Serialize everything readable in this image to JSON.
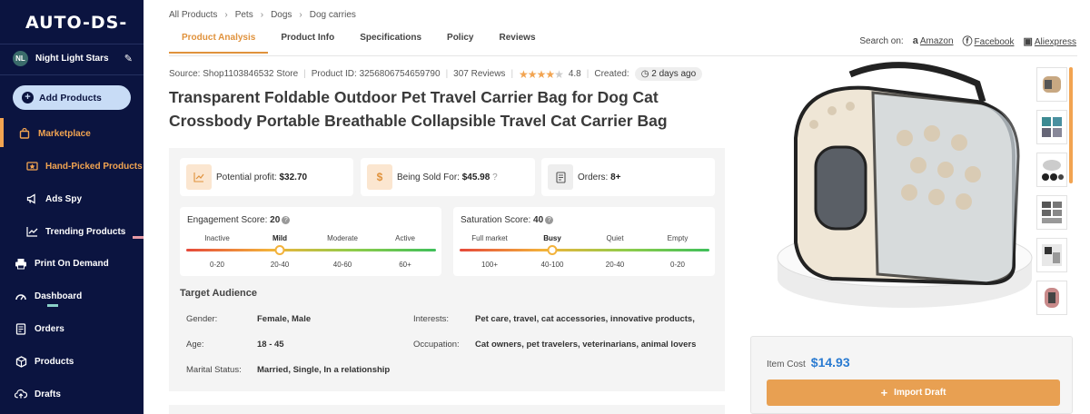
{
  "sidebar": {
    "logo": "AUTO-DS-",
    "store": {
      "initials": "NL",
      "name": "Night Light Stars"
    },
    "add_button": "Add Products",
    "items": [
      {
        "label": "Marketplace",
        "icon": "bag-icon"
      },
      {
        "label": "Hand-Picked Products",
        "icon": "star-icon"
      },
      {
        "label": "Ads Spy",
        "icon": "megaphone-icon"
      },
      {
        "label": "Trending Products",
        "icon": "trend-icon"
      },
      {
        "label": "Print On Demand",
        "icon": "printer-icon"
      },
      {
        "label": "Dashboard",
        "icon": "gauge-icon"
      },
      {
        "label": "Orders",
        "icon": "orders-icon"
      },
      {
        "label": "Products",
        "icon": "box-icon"
      },
      {
        "label": "Drafts",
        "icon": "cloud-upload-icon"
      }
    ]
  },
  "breadcrumb": [
    "All Products",
    "Pets",
    "Dogs",
    "Dog carries"
  ],
  "tabs": [
    "Product Analysis",
    "Product Info",
    "Specifications",
    "Policy",
    "Reviews"
  ],
  "search_on": {
    "label": "Search on:",
    "links": [
      "Amazon",
      "Facebook",
      "Aliexpress"
    ]
  },
  "meta": {
    "source": "Source: Shop1103846532 Store",
    "product_id": "Product ID: 3256806754659790",
    "reviews": "307 Reviews",
    "rating": "4.8",
    "rating_value": 4,
    "created_label": "Created:",
    "created_value": "2 days ago"
  },
  "product": {
    "title_line1": "Transparent Foldable Outdoor Pet Travel Carrier Bag for Dog Cat",
    "title_line2": "Crossbody Portable Breathable Collapsible Travel Cat Carrier Bag"
  },
  "stats": {
    "profit_label": "Potential profit:",
    "profit_value": "$32.70",
    "sold_label": "Being Sold For:",
    "sold_value": "$45.98",
    "orders_label": "Orders:",
    "orders_value": "8+"
  },
  "engagement": {
    "label": "Engagement Score:",
    "score": "20",
    "levels": [
      "Inactive",
      "Mild",
      "Moderate",
      "Active"
    ],
    "ranges": [
      "0-20",
      "20-40",
      "40-60",
      "60+"
    ],
    "active_level": 1
  },
  "saturation": {
    "label": "Saturation Score:",
    "score": "40",
    "levels": [
      "Full market",
      "Busy",
      "Quiet",
      "Empty"
    ],
    "ranges": [
      "100+",
      "40-100",
      "20-40",
      "0-20"
    ],
    "active_level": 1
  },
  "audience": {
    "title": "Target Audience",
    "gender_label": "Gender:",
    "gender_value": "Female, Male",
    "age_label": "Age:",
    "age_value": "18 - 45",
    "marital_label": "Marital Status:",
    "marital_value": "Married, Single, In a relationship",
    "interests_label": "Interests:",
    "interests_value": "Pet care, travel, cat accessories, innovative products,",
    "occupation_label": "Occupation:",
    "occupation_value": "Cat owners, pet travelers, veterinarians, animal lovers"
  },
  "buy": {
    "cost_label": "Item Cost",
    "cost_value": "$14.93",
    "import_label": "Import Draft"
  },
  "colors": {
    "sidebar_bg": "#0b1440",
    "accent": "#e0923c",
    "price_blue": "#2a7bd1"
  }
}
